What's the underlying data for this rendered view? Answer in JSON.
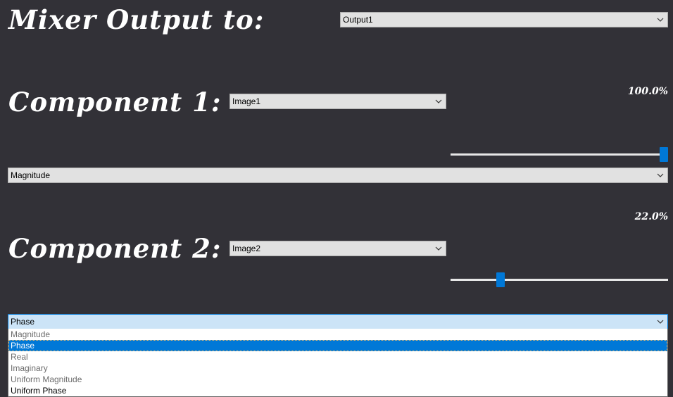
{
  "colors": {
    "background": "#323137",
    "title_text": "#ffffff",
    "combo_bg": "#e1e1e1",
    "accent": "#0078d7",
    "focused_combo_bg": "#cce4f7"
  },
  "header": {
    "title": "Mixer Output to:",
    "output_select": {
      "value": "Output1"
    }
  },
  "component1": {
    "title": "Component 1:",
    "image_select": {
      "value": "Image1"
    },
    "percent_label": "100.0%",
    "slider": {
      "value_percent": 100
    },
    "mode_select": {
      "value": "Magnitude"
    }
  },
  "component2": {
    "title": "Component 2:",
    "image_select": {
      "value": "Image2"
    },
    "percent_label": "22.0%",
    "slider": {
      "value_percent": 22
    },
    "mode_select": {
      "value": "Phase",
      "open": true,
      "options": [
        "Magnitude",
        "Phase",
        "Real",
        "Imaginary",
        "Uniform Magnitude",
        "Uniform Phase"
      ],
      "highlighted_index": 1
    }
  }
}
